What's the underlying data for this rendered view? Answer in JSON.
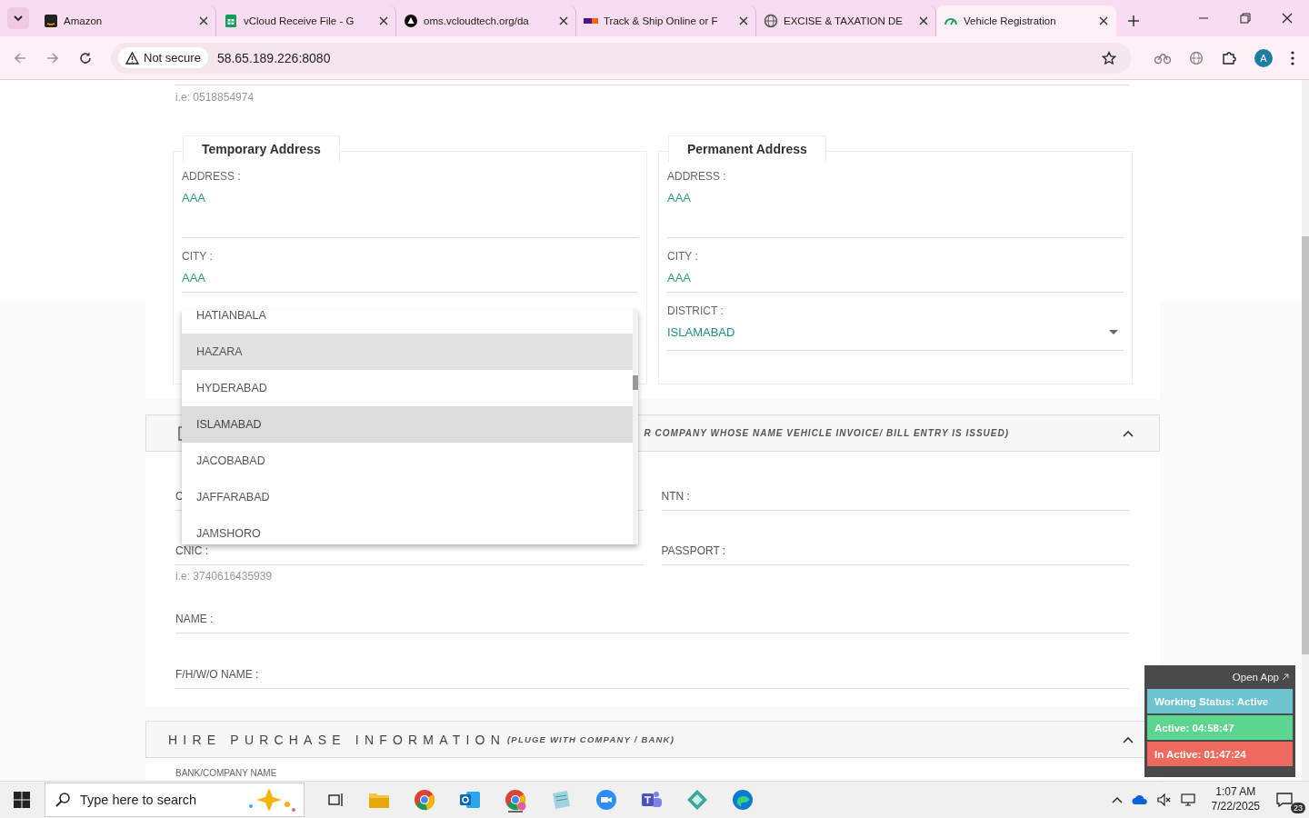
{
  "browser": {
    "tabs": [
      {
        "title": "Amazon",
        "selected": false
      },
      {
        "title": "vCloud Receive File - G",
        "selected": false
      },
      {
        "title": "oms.vcloudtech.org/da",
        "selected": false
      },
      {
        "title": "Track & Ship Online or F",
        "selected": false
      },
      {
        "title": "EXCISE & TAXATION DE",
        "selected": false
      },
      {
        "title": "Vehicle Registration",
        "selected": true
      }
    ],
    "security": "Not secure",
    "url": "58.65.189.226:8080",
    "profile_initial": "A"
  },
  "page": {
    "phone_hint": "i.e: 0518854974",
    "addresses": [
      {
        "legend": "Temporary Address",
        "fields": [
          {
            "kind": "textarea",
            "label": "ADDRESS :",
            "value": "AAA"
          },
          {
            "kind": "text",
            "label": "CITY :",
            "value": "AAA"
          }
        ]
      },
      {
        "legend": "Permanent Address",
        "fields": [
          {
            "kind": "textarea",
            "label": "ADDRESS :",
            "value": "AAA"
          },
          {
            "kind": "text",
            "label": "CITY :",
            "value": "AAA"
          },
          {
            "kind": "select",
            "label": "DISTRICT :",
            "value": "ISLAMABAD"
          }
        ]
      }
    ],
    "district_dropdown": {
      "options": [
        {
          "label": "HATIANBALA",
          "selected": false,
          "highlighted": false
        },
        {
          "label": "HAZARA",
          "selected": false,
          "highlighted": true
        },
        {
          "label": "HYDERABAD",
          "selected": false,
          "highlighted": false
        },
        {
          "label": "ISLAMABAD",
          "selected": true,
          "highlighted": false
        },
        {
          "label": "JACOBABAD",
          "selected": false,
          "highlighted": false
        },
        {
          "label": "JAFFARABAD",
          "selected": false,
          "highlighted": false
        },
        {
          "label": "JAMSHORO",
          "selected": false,
          "highlighted": false
        }
      ]
    },
    "owner_section": {
      "title_fragment": "R COMPANY WHOSE NAME VEHICLE INVOICE/ BILL ENTRY IS ISSUED)",
      "expanded": true,
      "fields": [
        {
          "label": "C",
          "wide": false
        },
        {
          "label": "NTN :",
          "wide": false
        },
        {
          "label": "CNIC :",
          "hint": "i.e: 3740616435939",
          "wide": false
        },
        {
          "label": "PASSPORT :",
          "wide": false
        },
        {
          "label": "NAME :",
          "wide": true
        },
        {
          "label": "F/H/W/O NAME :",
          "wide": true
        }
      ]
    },
    "hire_section": {
      "title": "HIRE PURCHASE INFORMATION",
      "subtitle": "(PLUGE WITH COMPANY / BANK)",
      "expanded": true,
      "first_label": "BANK/COMPANY NAME"
    }
  },
  "status_widget": {
    "open_app": "Open App",
    "statuses": [
      {
        "text": "Working Status: Active",
        "color": "#6ec3d0"
      },
      {
        "text": "Active: 04:58:47",
        "color": "#5cd68f"
      },
      {
        "text": "In Active: 01:47:24",
        "color": "#ef6a5e"
      }
    ]
  },
  "taskbar": {
    "search_placeholder": "Type here to search",
    "time": "1:07 AM",
    "date": "7/22/2025",
    "notification_count": "23"
  }
}
